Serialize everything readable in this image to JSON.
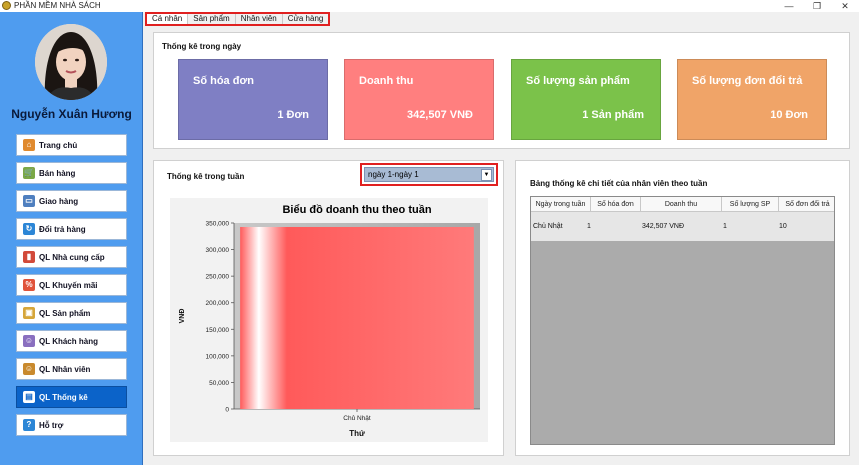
{
  "window": {
    "title": "PHẦN MỀM NHÀ SÁCH"
  },
  "user": {
    "name": "Nguyễn Xuân Hương"
  },
  "nav": {
    "items": [
      {
        "label": "Trang chủ",
        "icon": "home-icon",
        "active": false
      },
      {
        "label": "Bán hàng",
        "icon": "cart-icon",
        "active": false
      },
      {
        "label": "Giao hàng",
        "icon": "truck-icon",
        "active": false
      },
      {
        "label": "Đổi trả hàng",
        "icon": "refresh-icon",
        "active": false
      },
      {
        "label": "QL Nhà cung cấp",
        "icon": "factory-icon",
        "active": false
      },
      {
        "label": "QL Khuyến mãi",
        "icon": "sale-badge-icon",
        "active": false
      },
      {
        "label": "QL Sản phẩm",
        "icon": "box-icon",
        "active": false
      },
      {
        "label": "QL Khách hàng",
        "icon": "customers-icon",
        "active": false
      },
      {
        "label": "QL Nhân viên",
        "icon": "employee-icon",
        "active": false
      },
      {
        "label": "QL Thống kê",
        "icon": "chart-icon",
        "active": true
      },
      {
        "label": "Hỗ trợ",
        "icon": "help-icon",
        "active": false
      }
    ]
  },
  "tabs": [
    "Cá nhân",
    "Sản phẩm",
    "Nhân viên",
    "Cửa hàng"
  ],
  "daily": {
    "title": "Thống kê trong ngày",
    "cards": [
      {
        "label": "Số hóa đơn",
        "value": "1  Đơn",
        "color": "#7f7fc4"
      },
      {
        "label": "Doanh thu",
        "value": "342,507   VNĐ",
        "color": "#ff7f7f"
      },
      {
        "label": "Số lượng sản phẩm",
        "value": "1  Sản phẩm",
        "color": "#7bc24a"
      },
      {
        "label": "Số lượng đơn đổi trả",
        "value": "10   Đơn",
        "color": "#f0a468"
      }
    ]
  },
  "weekly": {
    "title": "Thống kê trong tuần",
    "range_select": "ngày 1-ngày 1"
  },
  "chart_data": {
    "type": "bar",
    "title": "Biểu đồ doanh thu theo tuần",
    "xlabel": "Thứ",
    "ylabel": "VNĐ",
    "categories": [
      "Chủ Nhật"
    ],
    "values": [
      342507
    ],
    "ylim": [
      0,
      350000
    ],
    "yticks": [
      0,
      50000,
      100000,
      150000,
      200000,
      250000,
      300000,
      350000
    ],
    "ytick_labels": [
      "0",
      "50,000",
      "100,000",
      "150,000",
      "200,000",
      "250,000",
      "300,000",
      "350,000"
    ],
    "bar_color": "#ff5a5a",
    "grid": false
  },
  "detail": {
    "title": "Bảng thống kê chi tiết của nhân viên theo tuần",
    "columns": [
      "Ngày trong tuần",
      "Số hóa đơn",
      "Doanh thu",
      "Số lượng SP",
      "Số đơn đổi trả"
    ],
    "rows": [
      [
        "Chủ Nhật",
        "1",
        "342,507 VNĐ",
        "1",
        "10"
      ]
    ]
  }
}
